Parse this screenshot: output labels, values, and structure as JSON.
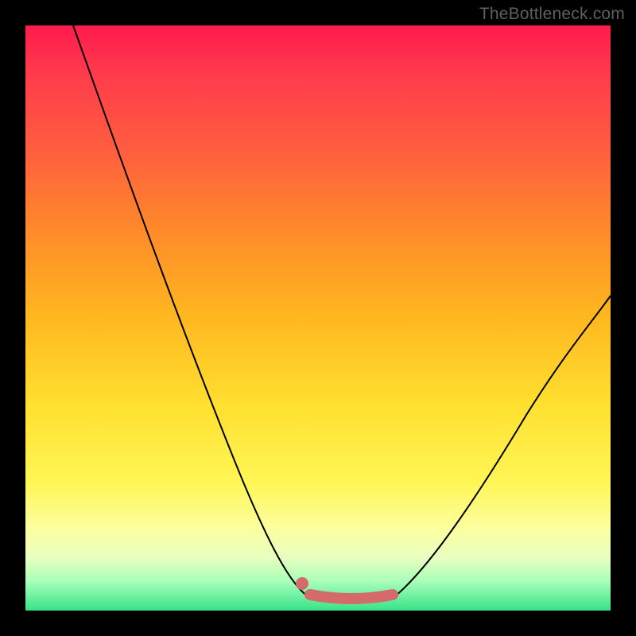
{
  "watermark": "TheBottleneck.com",
  "chart_data": {
    "type": "line",
    "title": "",
    "xlabel": "",
    "ylabel": "",
    "xlim": [
      0,
      100
    ],
    "ylim": [
      0,
      100
    ],
    "grid": false,
    "legend": false,
    "series": [
      {
        "name": "left-branch",
        "x": [
          8,
          14,
          20,
          26,
          32,
          38,
          44,
          48
        ],
        "y": [
          100,
          86,
          72,
          58,
          44,
          30,
          14,
          4
        ]
      },
      {
        "name": "right-branch",
        "x": [
          63,
          68,
          74,
          80,
          86,
          92,
          98
        ],
        "y": [
          4,
          10,
          18,
          27,
          36,
          45,
          54
        ]
      },
      {
        "name": "basin-flat-highlight",
        "x": [
          48,
          55,
          63
        ],
        "y": [
          3,
          2,
          3
        ]
      }
    ],
    "annotations": [
      {
        "kind": "dot",
        "x": 47,
        "y": 5
      }
    ],
    "background_gradient": {
      "top": "#ff1a4d",
      "bottom": "#38e28a"
    }
  }
}
